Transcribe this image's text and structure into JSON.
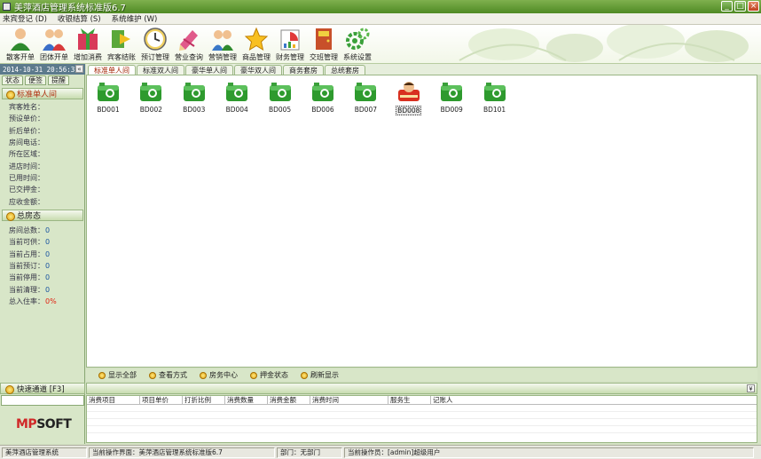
{
  "window": {
    "title": "美萍酒店管理系统标准版6.7",
    "min_label": "_",
    "max_label": "□",
    "close_label": "×"
  },
  "menu": [
    "来宾登记 (D)",
    "收银结算 (S)",
    "系统维护 (W)"
  ],
  "toolbar": [
    {
      "label": "散客开单",
      "icon": "person-icon"
    },
    {
      "label": "团体开单",
      "icon": "group-icon"
    },
    {
      "label": "增加消费",
      "icon": "gift-icon"
    },
    {
      "label": "宾客结账",
      "icon": "arrow-right-icon"
    },
    {
      "label": "预订管理",
      "icon": "clock-icon"
    },
    {
      "label": "营业查询",
      "icon": "pencil-icon"
    },
    {
      "label": "营销管理",
      "icon": "people-icon"
    },
    {
      "label": "商品管理",
      "icon": "star-icon"
    },
    {
      "label": "财务管理",
      "icon": "chart-icon"
    },
    {
      "label": "交班管理",
      "icon": "exit-door-icon"
    },
    {
      "label": "系统设置",
      "icon": "gear-icon"
    }
  ],
  "left": {
    "datetime": "2014-10-31 20:56:37",
    "collapse": "«",
    "tabs": [
      "状态",
      "便签",
      "提醒"
    ],
    "room_section": {
      "title": "标准单人间",
      "fields": [
        "宾客姓名：",
        "预设单价：",
        "折后单价：",
        "房间电话：",
        "所在区域：",
        "进店时间：",
        "已用时间：",
        "已交押金：",
        "应收金额："
      ]
    },
    "summary_section": {
      "title": "总房态",
      "fields": [
        {
          "k": "房间总数：",
          "v": "0"
        },
        {
          "k": "当前可供：",
          "v": "0"
        },
        {
          "k": "当前占用：",
          "v": "0"
        },
        {
          "k": "当前预订：",
          "v": "0"
        },
        {
          "k": "当前停用：",
          "v": "0"
        },
        {
          "k": "当前清理：",
          "v": "0"
        },
        {
          "k": "总入住率：",
          "v": "0%"
        }
      ]
    },
    "brand_main": "MP",
    "brand_rest": "SOFT"
  },
  "room_tabs": [
    "标准单人间",
    "标准双人间",
    "豪华单人间",
    "豪华双人间",
    "商务套房",
    "总统套房"
  ],
  "rooms": [
    {
      "name": "BD001",
      "status": "free"
    },
    {
      "name": "BD002",
      "status": "free"
    },
    {
      "name": "BD003",
      "status": "free"
    },
    {
      "name": "BD004",
      "status": "free"
    },
    {
      "name": "BD005",
      "status": "free"
    },
    {
      "name": "BD006",
      "status": "free"
    },
    {
      "name": "BD007",
      "status": "free"
    },
    {
      "name": "BD008",
      "status": "occupied"
    },
    {
      "name": "BD009",
      "status": "free"
    },
    {
      "name": "BD101",
      "status": "free"
    }
  ],
  "actions": [
    "显示全部",
    "查看方式",
    "房务中心",
    "押金状态",
    "刷新显示"
  ],
  "quick": {
    "title": "快速通道 [F3]",
    "expand": "¥"
  },
  "consumption_columns": [
    "消费项目",
    "项目单价",
    "打折比例",
    "消费数量",
    "消费金额",
    "消费时间",
    "服务生",
    "记账人"
  ],
  "status": {
    "system": "美萍酒店管理系统",
    "current_screen": "当前操作界面：美萍酒店管理系统标准版6.7",
    "department": "部门：无部门",
    "operator": "当前操作员：[admin]超级用户"
  },
  "colors": {
    "title_green": "#5f9a30",
    "panel_green": "#d8e6c8",
    "room_green": "#2e9a2e",
    "occupied_red": "#d83020"
  }
}
